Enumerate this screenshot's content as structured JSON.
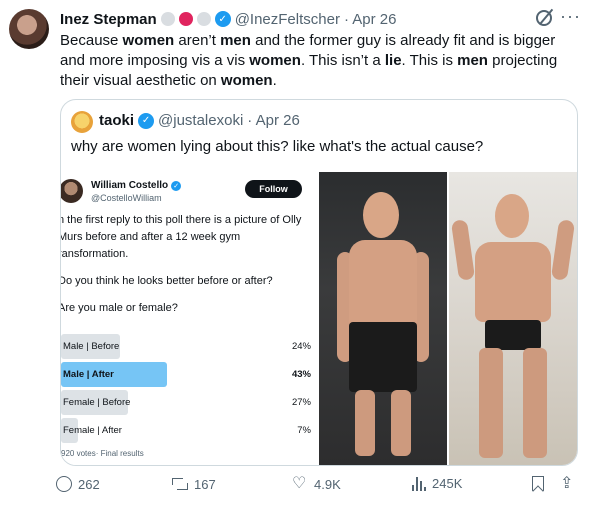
{
  "tweet": {
    "author": "Inez Stepman",
    "handle": "@InezFeltscher",
    "time": "· Apr 26",
    "emoji_colors": [
      "#d9dde1",
      "#e0245e",
      "#d9dde1"
    ],
    "text_parts": [
      "Because ",
      "women",
      " aren’t ",
      "men",
      " and the former guy is already fit and is bigger and more imposing vis a vis ",
      "women",
      ". This isn’t a ",
      "lie",
      ". This is ",
      "men",
      " projecting their visual aesthetic on ",
      "women",
      "."
    ]
  },
  "quote": {
    "author": "taoki",
    "handle": "@justalexoki",
    "time": "· Apr 26",
    "text": "why are women lying about this? like what's the actual cause?"
  },
  "poll_image": {
    "author": "William Costello",
    "handle": "@CostelloWilliam",
    "follow_label": "Follow",
    "paragraphs": [
      "n the first reply to this poll there is a picture of Olly Murs before and after a 12 week gym ransformation.",
      "Do you think he looks better before or after?",
      "Are you male or female?"
    ],
    "options": [
      {
        "label": "Male | Before",
        "pct": "24%",
        "value": 24,
        "winner": false
      },
      {
        "label": "Male | After",
        "pct": "43%",
        "value": 43,
        "winner": true
      },
      {
        "label": "Female | Before",
        "pct": "27%",
        "value": 27,
        "winner": false
      },
      {
        "label": "Female | After",
        "pct": "7%",
        "value": 7,
        "winner": false
      }
    ],
    "footer": "920 votes· Final results"
  },
  "actions": {
    "replies": "262",
    "reposts": "167",
    "likes": "4.9K",
    "views": "245K"
  },
  "colors": {
    "accent": "#1d9bf0",
    "poll_winner": "#76c5f5",
    "poll_bar": "#dde2e6",
    "muted": "#536471"
  }
}
